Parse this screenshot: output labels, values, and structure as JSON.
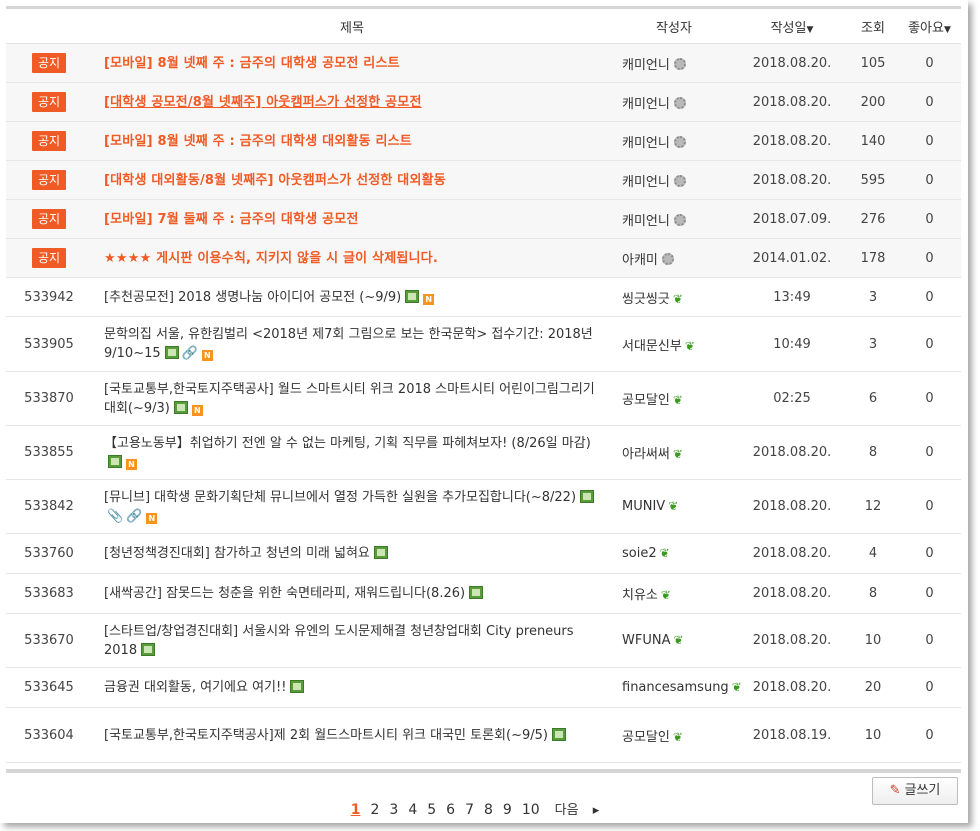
{
  "header": {
    "num": "",
    "subject": "제목",
    "author": "작성자",
    "date": "작성일",
    "views": "조회",
    "likes": "좋아요"
  },
  "notice_badge": "공지",
  "notices": [
    {
      "title": "[모바일] 8월 넷째 주 : 금주의 대학생 공모전 리스트",
      "author": "캐미언니",
      "date": "2018.08.20.",
      "views": "105",
      "likes": "0",
      "underline": false
    },
    {
      "title": "[대학생 공모전/8월 넷째주] 아웃캠퍼스가 선정한 공모전",
      "author": "캐미언니",
      "date": "2018.08.20.",
      "views": "200",
      "likes": "0",
      "underline": true
    },
    {
      "title": "[모바일] 8월 넷째 주 : 금주의 대학생 대외활동 리스트",
      "author": "캐미언니",
      "date": "2018.08.20.",
      "views": "140",
      "likes": "0",
      "underline": false
    },
    {
      "title": "[대학생 대외활동/8월 넷째주] 아웃캠퍼스가 선정한 대외활동",
      "author": "캐미언니",
      "date": "2018.08.20.",
      "views": "595",
      "likes": "0",
      "underline": false
    },
    {
      "title": "[모바일] 7월 둘째 주 : 금주의 대학생 공모전",
      "author": "캐미언니",
      "date": "2018.07.09.",
      "views": "276",
      "likes": "0",
      "underline": false
    },
    {
      "title": "★★★★ 게시판 이용수칙, 지키지 않을 시 글이 삭제됩니다.",
      "author": "아캐미",
      "date": "2014.01.02.",
      "views": "178",
      "likes": "0",
      "underline": false
    }
  ],
  "posts": [
    {
      "num": "533942",
      "title": "[추천공모전] 2018 생명나눔 아이디어 공모전 (~9/9)",
      "icons": [
        "image",
        "new"
      ],
      "author": "씽긋씽긋",
      "date": "13:49",
      "views": "3",
      "likes": "0"
    },
    {
      "num": "533905",
      "title": "문학의집 서울, 유한킴벌리 <2018년 제7회 그림으로 보는 한국문학> 접수기간: 2018년 9/10~15",
      "icons": [
        "image",
        "link",
        "new"
      ],
      "author": "서대문신부",
      "date": "10:49",
      "views": "3",
      "likes": "0"
    },
    {
      "num": "533870",
      "title": "[국토교통부,한국토지주택공사] 월드 스마트시티 위크 2018 스마트시티 어린이그림그리기 대회(~9/3)",
      "icons": [
        "image",
        "new"
      ],
      "author": "공모달인",
      "date": "02:25",
      "views": "6",
      "likes": "0"
    },
    {
      "num": "533855",
      "title": "【고용노동부】취업하기 전엔 알 수 없는 마케팅, 기획 직무를 파헤쳐보자! (8/26일 마감)",
      "icons": [
        "image",
        "new"
      ],
      "author": "아라써써",
      "date": "2018.08.20.",
      "views": "8",
      "likes": "0"
    },
    {
      "num": "533842",
      "title": "[뮤니브] 대학생 문화기획단체 뮤니브에서 열정 가득한 실원을 추가모집합니다(~8/22)",
      "icons": [
        "image",
        "file",
        "link",
        "new"
      ],
      "author": "MUNIV",
      "date": "2018.08.20.",
      "views": "12",
      "likes": "0"
    },
    {
      "num": "533760",
      "title": "[청년정책경진대회] 참가하고 청년의 미래 넓혀요",
      "icons": [
        "image"
      ],
      "author": "soie2",
      "date": "2018.08.20.",
      "views": "4",
      "likes": "0"
    },
    {
      "num": "533683",
      "title": "[새싹공간] 잠못드는 청춘을 위한 숙면테라피, 재워드립니다(8.26)",
      "icons": [
        "image"
      ],
      "author": "치유소",
      "date": "2018.08.20.",
      "views": "8",
      "likes": "0"
    },
    {
      "num": "533670",
      "title": "[스타트업/창업경진대회] 서울시와 유엔의 도시문제해결 청년창업대회 City preneurs 2018",
      "icons": [
        "image"
      ],
      "author": "WFUNA",
      "date": "2018.08.20.",
      "views": "10",
      "likes": "0"
    },
    {
      "num": "533645",
      "title": "금융권 대외활동, 여기에요 여기!!",
      "icons": [
        "image"
      ],
      "author": "financesamsung",
      "date": "2018.08.20.",
      "views": "20",
      "likes": "0"
    },
    {
      "num": "533604",
      "title": "[국토교통부,한국토지주택공사]제 2회 월드스마트시티 위크 대국민 토론회(~9/5)",
      "icons": [
        "image"
      ],
      "author": "공모달인",
      "date": "2018.08.19.",
      "views": "10",
      "likes": "0"
    }
  ],
  "write_button": "글쓰기",
  "pagination": {
    "pages": [
      "1",
      "2",
      "3",
      "4",
      "5",
      "6",
      "7",
      "8",
      "9",
      "10"
    ],
    "current": "1",
    "next": "다음"
  }
}
